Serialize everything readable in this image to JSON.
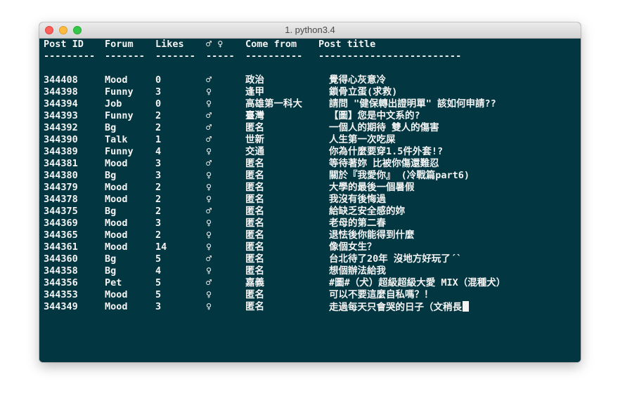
{
  "window": {
    "title": "1. python3.4"
  },
  "header": {
    "id": "Post ID",
    "forum": "Forum",
    "likes": "Likes",
    "sex": "♂ ♀",
    "from": "Come from",
    "title": "Post title"
  },
  "separator": {
    "id": "---------",
    "forum": "-------",
    "likes": "-------",
    "sex": "-----",
    "from": "----------",
    "title": "-------------------------"
  },
  "rows": [
    {
      "id": "344408",
      "forum": "Mood",
      "likes": "0",
      "sex": "♂",
      "from": "政治",
      "title": "覺得心灰意冷"
    },
    {
      "id": "344398",
      "forum": "Funny",
      "likes": "3",
      "sex": "♀",
      "from": "逢甲",
      "title": "鎖骨立蛋(求救)"
    },
    {
      "id": "344394",
      "forum": "Job",
      "likes": "0",
      "sex": "♀",
      "from": "高雄第一科大",
      "title": "   請問 \"健保轉出證明單\" 該如何申請??"
    },
    {
      "id": "344393",
      "forum": "Funny",
      "likes": "2",
      "sex": "♂",
      "from": "臺灣",
      "title": "【圖】您是中文系的?"
    },
    {
      "id": "344392",
      "forum": "Bg",
      "likes": "2",
      "sex": "♂",
      "from": "匿名",
      "title": "一個人的期待 雙人的傷害"
    },
    {
      "id": "344390",
      "forum": "Talk",
      "likes": "1",
      "sex": "♂",
      "from": "世新",
      "title": "人生第一次吃屎"
    },
    {
      "id": "344389",
      "forum": "Funny",
      "likes": "4",
      "sex": "♀",
      "from": "交通",
      "title": "你為什麼要穿1.5件外套!?"
    },
    {
      "id": "344381",
      "forum": "Mood",
      "likes": "3",
      "sex": "♂",
      "from": "匿名",
      "title": "等待著妳 比被你傷還難忍"
    },
    {
      "id": "344380",
      "forum": "Bg",
      "likes": "3",
      "sex": "♀",
      "from": "匿名",
      "title": "關於『我愛你』 (冷戰篇part6)"
    },
    {
      "id": "344379",
      "forum": "Mood",
      "likes": "2",
      "sex": "♀",
      "from": "匿名",
      "title": "大學的最後一個暑假"
    },
    {
      "id": "344378",
      "forum": "Mood",
      "likes": "2",
      "sex": "♀",
      "from": "匿名",
      "title": "我沒有後悔過"
    },
    {
      "id": "344375",
      "forum": "Bg",
      "likes": "2",
      "sex": "♂",
      "from": "匿名",
      "title": "給缺乏安全感的妳"
    },
    {
      "id": "344369",
      "forum": "Mood",
      "likes": "3",
      "sex": "♀",
      "from": "匿名",
      "title": "老母的第二春"
    },
    {
      "id": "344365",
      "forum": "Mood",
      "likes": "2",
      "sex": "♀",
      "from": "匿名",
      "title": "退怯後你能得到什麼"
    },
    {
      "id": "344361",
      "forum": "Mood",
      "likes": "14",
      "sex": "♀",
      "from": "匿名",
      "title": "像個女生？"
    },
    {
      "id": "344360",
      "forum": "Bg",
      "likes": "5",
      "sex": "♂",
      "from": "匿名",
      "title": "台北待了20年 沒地方好玩了´`"
    },
    {
      "id": "344358",
      "forum": "Bg",
      "likes": "4",
      "sex": "♀",
      "from": "匿名",
      "title": "想個辦法給我"
    },
    {
      "id": "344356",
      "forum": "Pet",
      "likes": "5",
      "sex": "♂",
      "from": "嘉義",
      "title": "#圖#（犬）超級超級大愛 MIX（混種犬）"
    },
    {
      "id": "344353",
      "forum": "Mood",
      "likes": "5",
      "sex": "♀",
      "from": "匿名",
      "title": "可以不要這麼自私嗎？！"
    },
    {
      "id": "344349",
      "forum": "Mood",
      "likes": "3",
      "sex": "♀",
      "from": "匿名",
      "title": "走過每天只會哭的日子（文稍長"
    }
  ],
  "colors": {
    "terminal_bg": "#023641",
    "terminal_fg": "#f4f4f4"
  }
}
